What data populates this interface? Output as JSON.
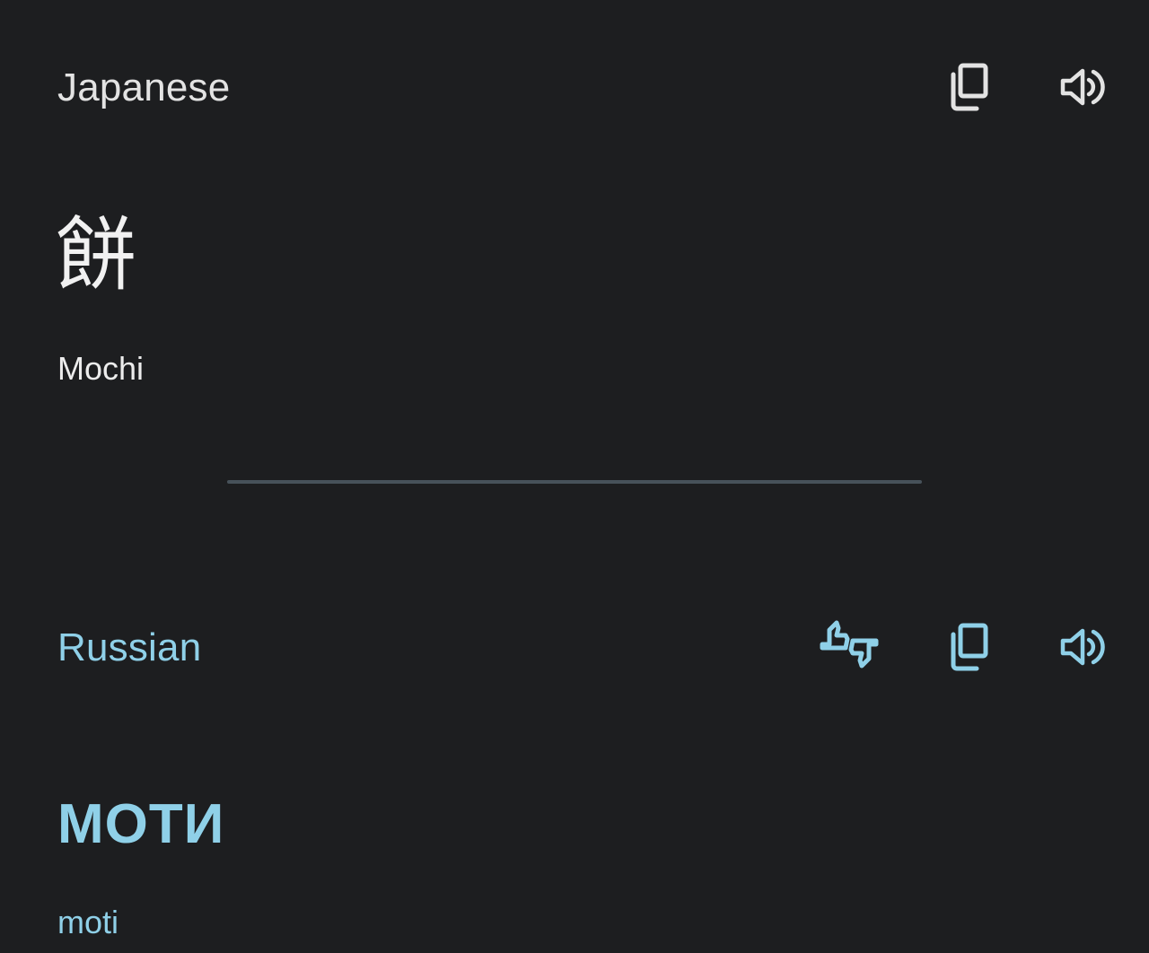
{
  "source": {
    "language": "Japanese",
    "text": "餅",
    "transliteration": "Mochi",
    "icons": {
      "copy": "copy-icon",
      "speak": "volume-icon"
    },
    "color": "#e3e3e3"
  },
  "target": {
    "language": "Russian",
    "text": "МОТИ",
    "transliteration": "moti",
    "icons": {
      "feedback": "thumbs-feedback-icon",
      "copy": "copy-icon",
      "speak": "volume-icon"
    },
    "color": "#8fd0e8"
  },
  "theme": {
    "background": "#1d1e20",
    "divider": "#47525a"
  }
}
